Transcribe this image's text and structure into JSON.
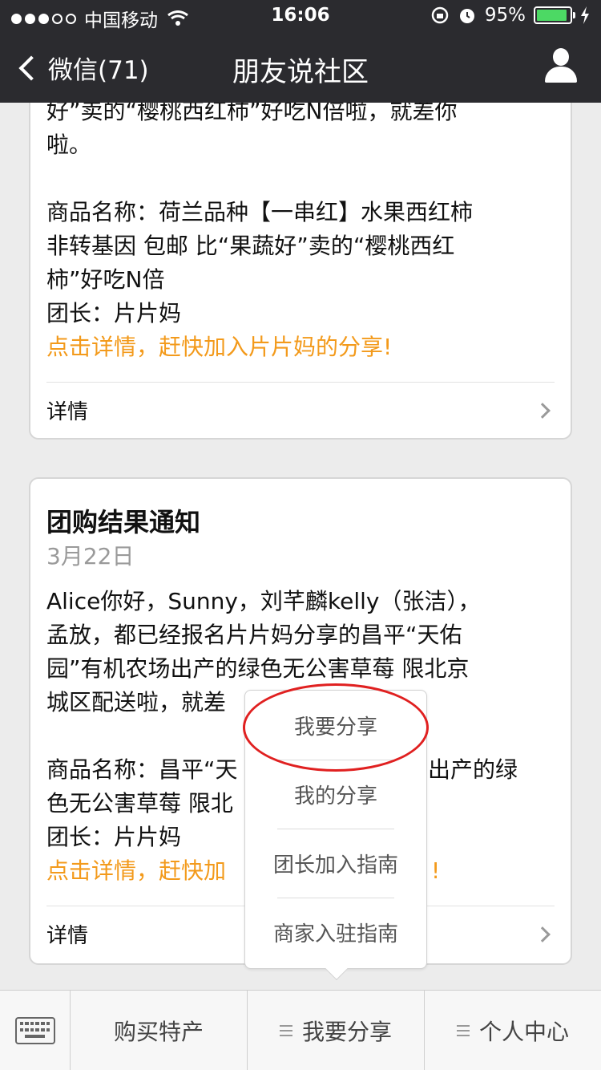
{
  "status_bar": {
    "carrier": "中国移动",
    "time": "16:06",
    "battery": "95%"
  },
  "nav": {
    "back_label": "微信(71)",
    "title": "朋友说社区"
  },
  "card1": {
    "lines": [
      "好”卖的“樱桃西红柿”好吃N倍啦，就差你",
      "啦。"
    ],
    "product_lines": [
      "商品名称：荷兰品种【一串红】水果西红柿",
      "非转基因 包邮 比“果蔬好”卖的“樱桃西红",
      "柿”好吃N倍"
    ],
    "leader": "团长：片片妈",
    "cta": "点击详情，赶快加入片片妈的分享!",
    "detail_label": "详情"
  },
  "card2": {
    "title": "团购结果通知",
    "date": "3月22日",
    "lines": [
      "Alice你好，Sunny，刘芊麟kelly（张洁），",
      "孟放，都已经报名片片妈分享的昌平“天佑",
      "园”有机农场出产的绿色无公害草莓 限北京",
      "城区配送啦，就差"
    ],
    "product_lines": [
      "商品名称：昌平“天",
      "色无公害草莓 限北"
    ],
    "product_tail": "出产的绿",
    "leader": "团长：片片妈",
    "cta": "点击详情，赶快加",
    "cta_tail": "!",
    "detail_label": "详情"
  },
  "popup_menu": {
    "items": [
      "我要分享",
      "我的分享",
      "团长加入指南",
      "商家入驻指南"
    ]
  },
  "toolbar": {
    "tabs": [
      "购买特产",
      "我要分享",
      "个人中心"
    ]
  }
}
